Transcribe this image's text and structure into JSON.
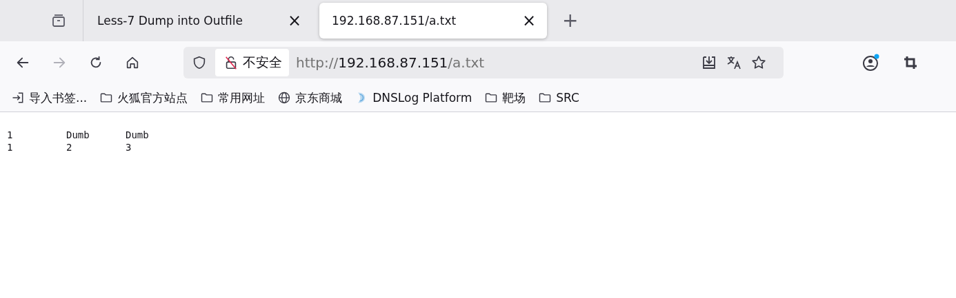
{
  "tabs": [
    {
      "title": "Less-7 Dump into Outfile",
      "close": "×",
      "selected": false
    },
    {
      "title": "192.168.87.151/a.txt",
      "close": "×",
      "selected": true
    }
  ],
  "new_tab": "+",
  "address_bar": {
    "security_label": "不安全",
    "url_scheme": "http://",
    "url_host": "192.168.87.151",
    "url_path": "/a.txt"
  },
  "bookmarks": [
    {
      "kind": "import",
      "label": "导入书签..."
    },
    {
      "kind": "folder",
      "label": "火狐官方站点"
    },
    {
      "kind": "folder",
      "label": "常用网址"
    },
    {
      "kind": "globe",
      "label": "京东商城"
    },
    {
      "kind": "site",
      "label": "DNSLog Platform"
    },
    {
      "kind": "folder",
      "label": "靶场"
    },
    {
      "kind": "folder",
      "label": "SRC"
    }
  ],
  "content": {
    "rows": [
      {
        "cells": [
          "1",
          "Dumb",
          "Dumb"
        ]
      },
      {
        "cells": [
          "1",
          "2",
          "3"
        ]
      }
    ]
  }
}
